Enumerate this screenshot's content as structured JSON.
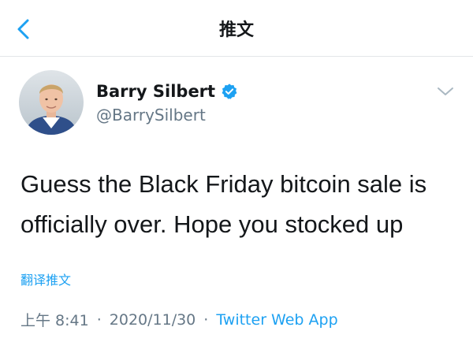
{
  "nav": {
    "title": "推文",
    "back_icon": "chevron-left-icon"
  },
  "author": {
    "name": "Barry Silbert",
    "handle": "@BarrySilbert",
    "verified_icon": "verified-badge-icon"
  },
  "tweet": {
    "text": "Guess the Black Friday bitcoin sale is officially over. Hope you stocked up"
  },
  "translate_label": "翻译推文",
  "meta": {
    "time": "上午 8:41",
    "separator": "·",
    "date": "2020/11/30",
    "source": "Twitter Web App"
  },
  "colors": {
    "accent": "#1da1f2",
    "secondary_text": "#657786",
    "divider": "#e3e6e8"
  }
}
